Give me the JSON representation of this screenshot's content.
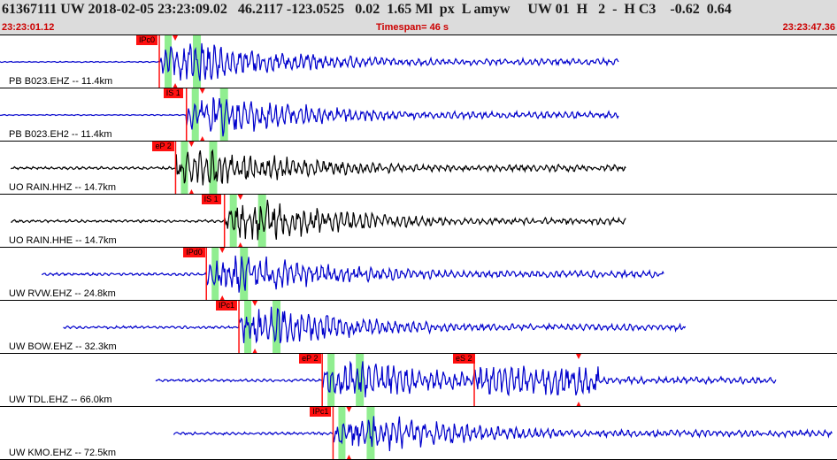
{
  "header": {
    "main": "61367111 UW 2018-02-05 23:23:09.02   46.2117 -123.0525   0.02  1.65 Ml  px  L amyw     UW 01  H   2  -  H C3    -0.62  0.64",
    "start_time": "23:23:01.12",
    "timespan": "Timespan=  46 s",
    "end_time": "23:23:47.36"
  },
  "colors": {
    "trace_blue": "#0000cc",
    "trace_black": "#000000",
    "pick_red": "#ff1010",
    "window_green": "#90ee90",
    "header_gray": "#dcdcdc",
    "header_time": "#cc0000"
  },
  "traces": [
    {
      "label": "PB B023.EHZ -- 11.4km",
      "color": "blue",
      "pick": "IPc0",
      "pick_time": 8.8,
      "start": 0,
      "end": 34.2
    },
    {
      "label": "PB B023.EH2 -- 11.4km",
      "color": "blue",
      "pick": "IS 1",
      "pick_time": 10.3,
      "start": 0,
      "end": 34.2
    },
    {
      "label": "UO RAIN.HHZ -- 14.7km",
      "color": "black",
      "pick": "eP 2",
      "pick_time": 9.7,
      "start": 0.6,
      "end": 34.6
    },
    {
      "label": "UO RAIN.HHE -- 14.7km",
      "color": "black",
      "pick": "IS 1",
      "pick_time": 12.4,
      "start": 0.6,
      "end": 34.6
    },
    {
      "label": "UW RVW.EHZ -- 24.8km",
      "color": "blue",
      "pick": "IPd0",
      "pick_time": 11.4,
      "start": 2.3,
      "end": 36.7
    },
    {
      "label": "UW BOW.EHZ -- 32.3km",
      "color": "blue",
      "pick": "IPc1",
      "pick_time": 13.2,
      "start": 3.5,
      "end": 37.9
    },
    {
      "label": "UW TDL.EHZ -- 66.0km",
      "color": "blue",
      "pick": "eP 2",
      "pick_time": 17.8,
      "pick2": "eS 2",
      "pick2_time": 26.2,
      "start": 8.6,
      "end": 42.9
    },
    {
      "label": "UW KMO.EHZ -- 72.5km",
      "color": "blue",
      "pick": "IPc1",
      "pick_time": 18.4,
      "start": 9.6,
      "end": 46.0
    }
  ]
}
